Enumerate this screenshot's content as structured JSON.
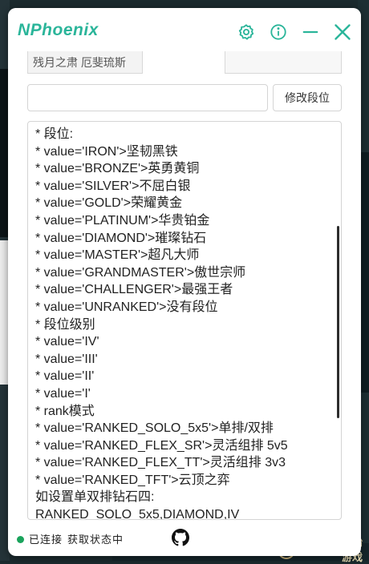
{
  "app": {
    "logo_text": "NPhoenix",
    "accent_color": "#2bb59a"
  },
  "titlebar": {
    "icons": [
      "gear-icon",
      "info-icon",
      "minimize-icon",
      "close-icon"
    ]
  },
  "previous_row": {
    "field_text": "残月之肃 厄斐琉斯"
  },
  "rank_input": {
    "value": "",
    "placeholder": ""
  },
  "modify_button": {
    "label": "修改段位"
  },
  "help_text": {
    "lines": [
      "* 段位:",
      "* value='IRON'>坚韧黑铁",
      "* value='BRONZE'>英勇黄铜",
      "* value='SILVER'>不屈白银",
      "* value='GOLD'>荣耀黄金",
      "* value='PLATINUM'>华贵铂金",
      "* value='DIAMOND'>璀璨钻石",
      "* value='MASTER'>超凡大师",
      "* value='GRANDMASTER'>傲世宗师",
      "* value='CHALLENGER'>最强王者",
      "* value='UNRANKED'>没有段位",
      "* 段位级别",
      "* value='IV'",
      "* value='III'",
      "* value='II'",
      "* value='I'",
      "* rank模式",
      "* value='RANKED_SOLO_5x5'>单排/双排",
      "* value='RANKED_FLEX_SR'>灵活组排 5v5",
      "* value='RANKED_FLEX_TT'>灵活组排 3v3",
      "* value='RANKED_TFT'>云顶之弈",
      "如设置单双排钻石四:",
      "RANKED_SOLO_5x5,DIAMOND,IV"
    ]
  },
  "status": {
    "connection": "已连接",
    "state": "获取状态中",
    "color": "#1aa35c"
  },
  "background": {
    "start_game": "开始游戏"
  }
}
